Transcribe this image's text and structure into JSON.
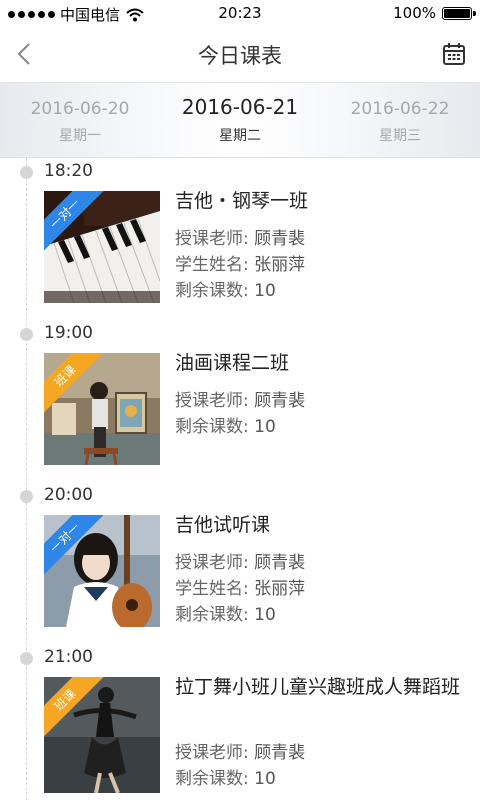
{
  "status_bar": {
    "carrier": "中国电信",
    "time": "20:23",
    "battery": "100%"
  },
  "nav": {
    "title": "今日课表"
  },
  "dates": {
    "prev": {
      "date": "2016-06-20",
      "weekday": "星期一"
    },
    "current": {
      "date": "2016-06-21",
      "weekday": "星期二"
    },
    "next": {
      "date": "2016-06-22",
      "weekday": "星期三"
    }
  },
  "labels": {
    "teacher": "授课老师:",
    "student": "学生姓名:",
    "remaining": "剩余课数:"
  },
  "classes": [
    {
      "time": "18:20",
      "tag": "一对一",
      "tag_color": "#2d86e8",
      "course": "吉他・钢琴一班",
      "teacher": "顾青裴",
      "student": "张丽萍",
      "remaining": "10",
      "image": "piano-keys"
    },
    {
      "time": "19:00",
      "tag": "班课",
      "tag_color": "#f5a623",
      "course": "油画课程二班",
      "teacher": "顾青裴",
      "remaining": "10",
      "image": "painting-studio"
    },
    {
      "time": "20:00",
      "tag": "一对一",
      "tag_color": "#2d86e8",
      "course": "吉他试听课",
      "teacher": "顾青裴",
      "student": "张丽萍",
      "remaining": "10",
      "image": "guitar-girl"
    },
    {
      "time": "21:00",
      "tag": "班课",
      "tag_color": "#f5a623",
      "course": "拉丁舞小班儿童兴趣班成人舞蹈班",
      "teacher": "顾青裴",
      "remaining": "10",
      "image": "dancer"
    }
  ]
}
